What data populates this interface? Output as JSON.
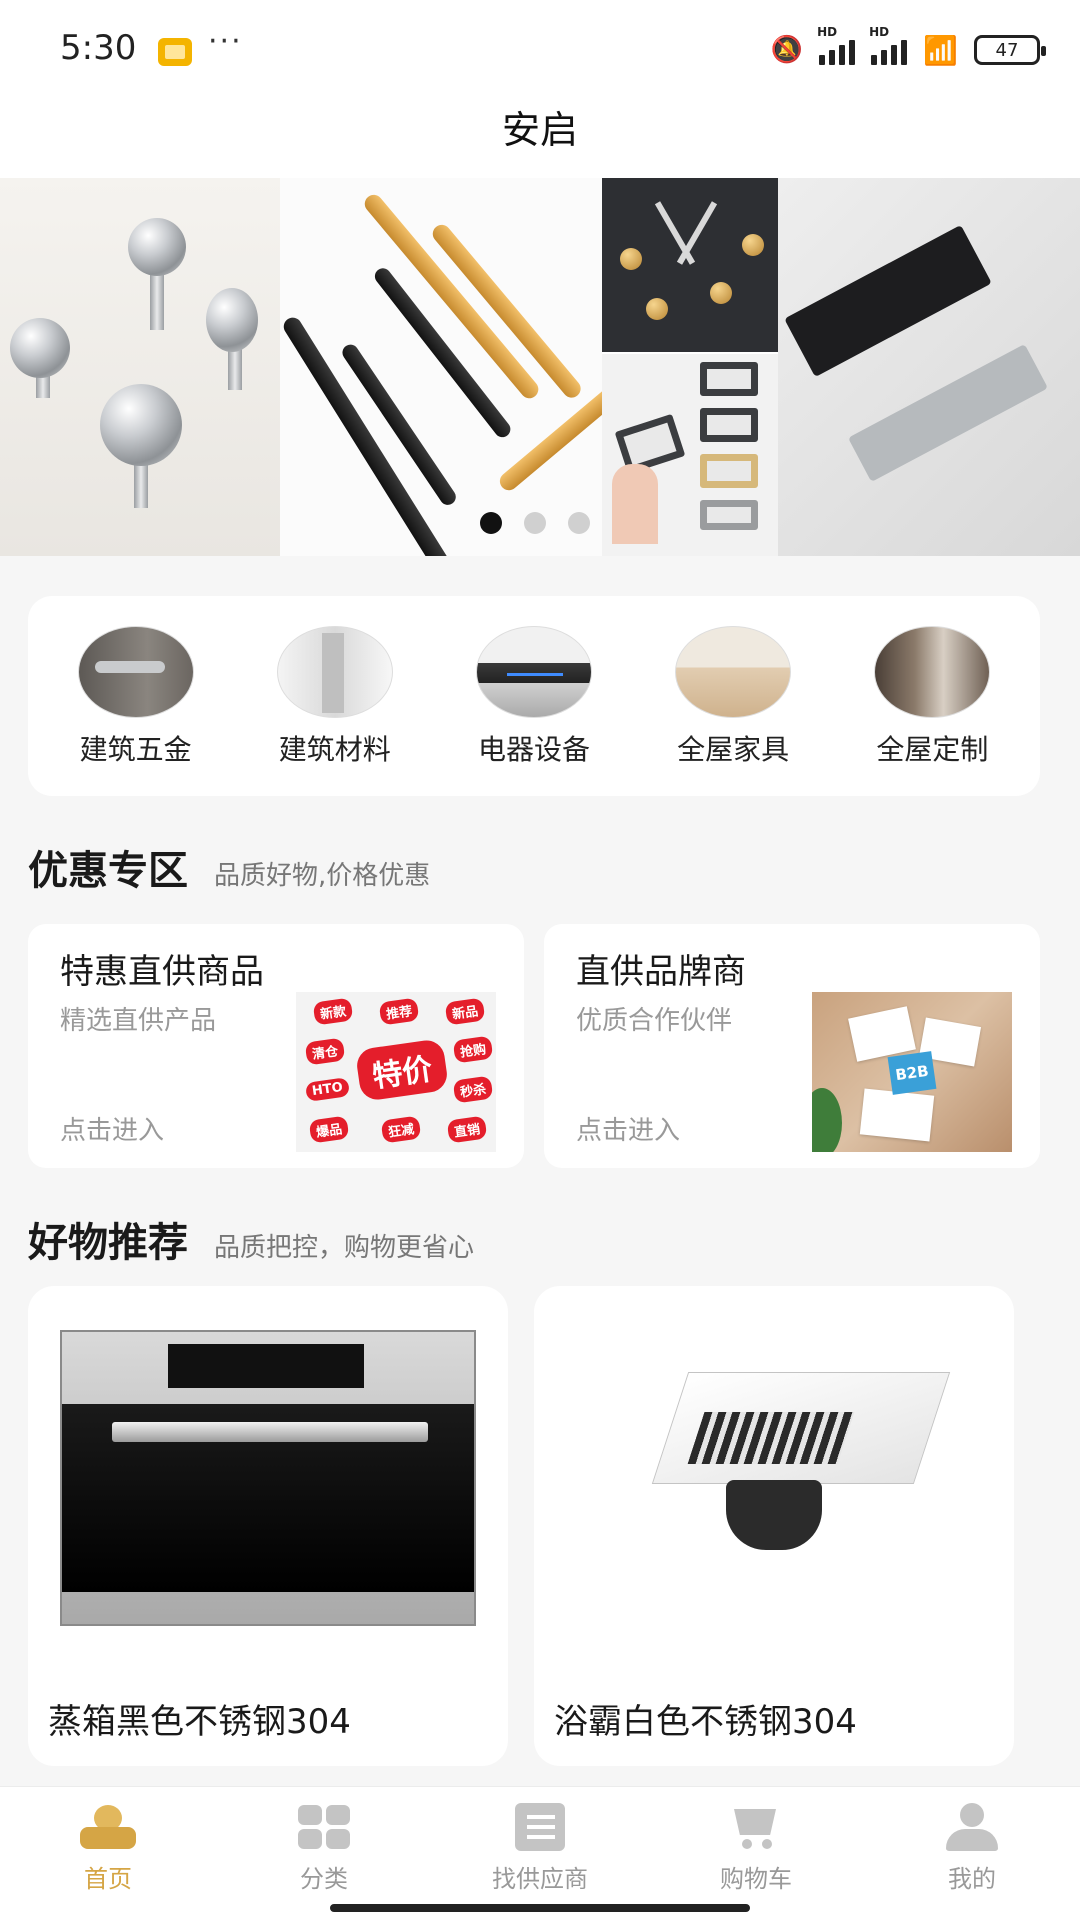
{
  "status_bar": {
    "time": "5:30",
    "more": "···",
    "battery": "47",
    "signal_label": "HD"
  },
  "header": {
    "title": "安启"
  },
  "banner": {
    "slide_count": 3,
    "active_slide": 1
  },
  "categories": [
    {
      "label": "建筑五金",
      "icon": "door-handle-image"
    },
    {
      "label": "建筑材料",
      "icon": "panel-material-image"
    },
    {
      "label": "电器设备",
      "icon": "range-hood-image"
    },
    {
      "label": "全屋家具",
      "icon": "sofa-image"
    },
    {
      "label": "全屋定制",
      "icon": "wardrobe-image"
    }
  ],
  "promo_section": {
    "title": "优惠专区",
    "subtitle": "品质好物,价格优惠"
  },
  "promos": [
    {
      "title": "特惠直供商品",
      "subtitle": "精选直供产品",
      "enter": "点击进入",
      "image_tags": [
        "新款",
        "推荐",
        "新品",
        "清仓",
        "抢购",
        "特价",
        "HTO",
        "秒杀",
        "爆品",
        "狂减",
        "直销"
      ]
    },
    {
      "title": "直供品牌商",
      "subtitle": "优质合作伙伴",
      "enter": "点击进入",
      "image_text": "B2B"
    }
  ],
  "rec_section": {
    "title": "好物推荐",
    "subtitle": "品质把控，购物更省心"
  },
  "products": [
    {
      "name": "蒸箱黑色不锈钢304",
      "image": "steam-oven-image"
    },
    {
      "name": "浴霸白色不锈钢304",
      "image": "bath-heater-image"
    }
  ],
  "tabs": [
    {
      "label": "首页",
      "icon": "home-icon",
      "active": true
    },
    {
      "label": "分类",
      "icon": "category-grid-icon"
    },
    {
      "label": "找供应商",
      "icon": "supplier-list-icon"
    },
    {
      "label": "购物车",
      "icon": "cart-icon"
    },
    {
      "label": "我的",
      "icon": "profile-icon"
    }
  ],
  "colors": {
    "accent": "#d5a545",
    "inactive": "#999999",
    "sale_red": "#e41e2b"
  }
}
